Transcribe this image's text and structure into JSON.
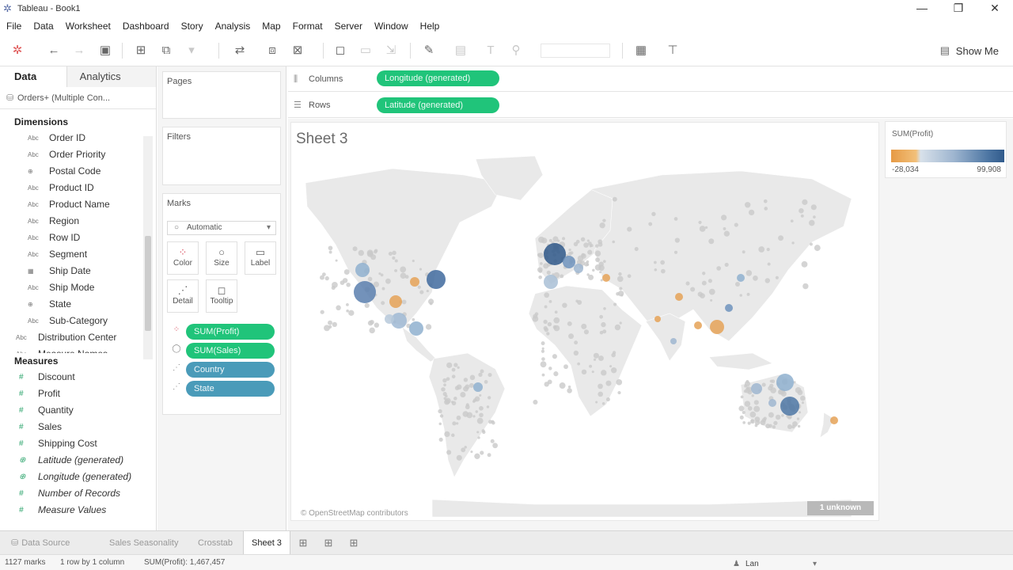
{
  "window": {
    "title": "Tableau - Book1",
    "controls": {
      "minimize": "—",
      "restore": "❐",
      "close": "✕"
    }
  },
  "menu": [
    "File",
    "Data",
    "Worksheet",
    "Dashboard",
    "Story",
    "Analysis",
    "Map",
    "Format",
    "Server",
    "Window",
    "Help"
  ],
  "toolbar": {
    "show_me": "Show Me"
  },
  "data_pane": {
    "tabs": [
      "Data",
      "Analytics"
    ],
    "datasource": "Orders+ (Multiple Con...",
    "dimensions_header": "Dimensions",
    "dimensions": [
      {
        "type": "Abc",
        "label": "Order ID"
      },
      {
        "type": "Abc",
        "label": "Order Priority"
      },
      {
        "type": "⊕",
        "label": "Postal Code"
      },
      {
        "type": "Abc",
        "label": "Product ID"
      },
      {
        "type": "Abc",
        "label": "Product Name"
      },
      {
        "type": "Abc",
        "label": "Region"
      },
      {
        "type": "Abc",
        "label": "Row ID"
      },
      {
        "type": "Abc",
        "label": "Segment"
      },
      {
        "type": "▦",
        "label": "Ship Date"
      },
      {
        "type": "Abc",
        "label": "Ship Mode"
      },
      {
        "type": "⊕",
        "label": "State"
      },
      {
        "type": "Abc",
        "label": "Sub-Category"
      },
      {
        "type": "Abc",
        "label": "Distribution Center"
      },
      {
        "type": "Abc",
        "label": "Measure Names"
      }
    ],
    "measures_header": "Measures",
    "measures": [
      {
        "type": "#",
        "label": "Discount",
        "italic": false
      },
      {
        "type": "#",
        "label": "Profit",
        "italic": false
      },
      {
        "type": "#",
        "label": "Quantity",
        "italic": false
      },
      {
        "type": "#",
        "label": "Sales",
        "italic": false
      },
      {
        "type": "#",
        "label": "Shipping Cost",
        "italic": false
      },
      {
        "type": "⊕",
        "label": "Latitude (generated)",
        "italic": true
      },
      {
        "type": "⊕",
        "label": "Longitude (generated)",
        "italic": true
      },
      {
        "type": "#",
        "label": "Number of Records",
        "italic": true
      },
      {
        "type": "#",
        "label": "Measure Values",
        "italic": true
      }
    ]
  },
  "cards": {
    "pages": "Pages",
    "filters": "Filters",
    "marks": {
      "title": "Marks",
      "mark_type": "Automatic",
      "buttons": [
        "Color",
        "Size",
        "Label",
        "Detail",
        "Tooltip"
      ],
      "pills": [
        {
          "icon": "color",
          "label": "SUM(Profit)",
          "kind": "green"
        },
        {
          "icon": "size",
          "label": "SUM(Sales)",
          "kind": "green"
        },
        {
          "icon": "detail",
          "label": "Country",
          "kind": "blue"
        },
        {
          "icon": "detail",
          "label": "State",
          "kind": "blue"
        }
      ]
    }
  },
  "shelves": {
    "columns_label": "Columns",
    "columns_pill": "Longitude (generated)",
    "rows_label": "Rows",
    "rows_pill": "Latitude (generated)"
  },
  "view": {
    "sheet_title": "Sheet 3",
    "attribution": "© OpenStreetMap contributors",
    "unknown_badge": "1 unknown"
  },
  "legend": {
    "title": "SUM(Profit)",
    "min": "-28,034",
    "max": "99,908"
  },
  "sheet_tabs": {
    "data_source": "Data Source",
    "tabs": [
      "Sales Seasonality",
      "Crosstab",
      "Sheet 3"
    ],
    "active": "Sheet 3"
  },
  "status": {
    "marks": "1127 marks",
    "dims": "1 row by 1 column",
    "sum": "SUM(Profit): 1,467,457",
    "user": "Lan"
  },
  "colors": {
    "green_pill": "#20c47a",
    "blue_pill": "#4a9bb9",
    "neg_profit": "#e69a45",
    "pos_profit": "#315b8c"
  }
}
